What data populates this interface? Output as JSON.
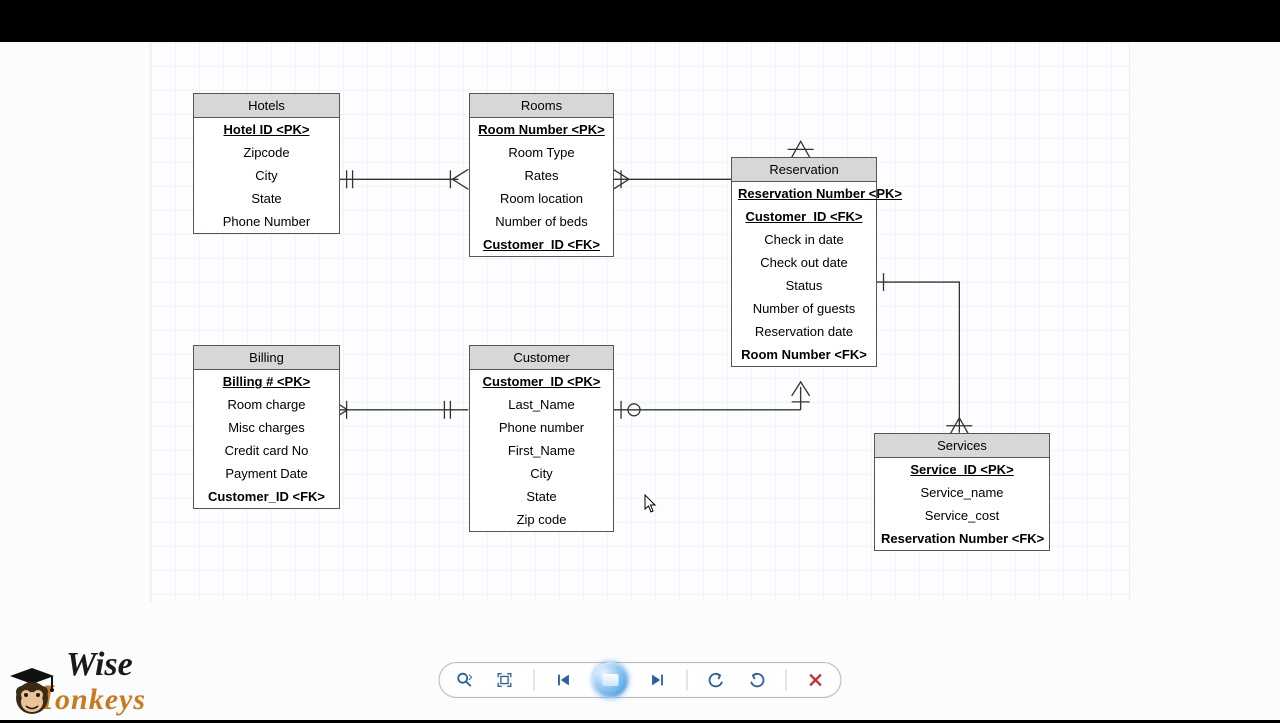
{
  "entities": {
    "hotels": {
      "title": "Hotels",
      "rows": [
        {
          "text": "Hotel ID <PK>",
          "cls": "pk"
        },
        {
          "text": "Zipcode"
        },
        {
          "text": "City"
        },
        {
          "text": "State"
        },
        {
          "text": "Phone Number"
        }
      ]
    },
    "rooms": {
      "title": "Rooms",
      "rows": [
        {
          "text": "Room Number <PK>",
          "cls": "pk"
        },
        {
          "text": "Room Type"
        },
        {
          "text": "Rates"
        },
        {
          "text": "Room location"
        },
        {
          "text": "Number of beds"
        },
        {
          "text": "Customer_ID <FK>",
          "cls": "fku"
        }
      ]
    },
    "reservation": {
      "title": "Reservation",
      "rows": [
        {
          "text": "Reservation Number <PK>",
          "cls": "pk"
        },
        {
          "text": "Customer_ID <FK>",
          "cls": "fku"
        },
        {
          "text": "Check in date"
        },
        {
          "text": "Check out date"
        },
        {
          "text": "Status"
        },
        {
          "text": "Number of guests"
        },
        {
          "text": "Reservation date"
        },
        {
          "text": "Room Number <FK>",
          "cls": "fk"
        }
      ]
    },
    "billing": {
      "title": "Billing",
      "rows": [
        {
          "text": "Billing # <PK>",
          "cls": "pk"
        },
        {
          "text": "Room charge"
        },
        {
          "text": "Misc charges"
        },
        {
          "text": "Credit card No"
        },
        {
          "text": "Payment Date"
        },
        {
          "text": "Customer_ID <FK>",
          "cls": "fk"
        }
      ]
    },
    "customer": {
      "title": "Customer",
      "rows": [
        {
          "text": "Customer_ID <PK>",
          "cls": "pk"
        },
        {
          "text": "Last_Name"
        },
        {
          "text": "Phone number"
        },
        {
          "text": "First_Name"
        },
        {
          "text": "City"
        },
        {
          "text": "State"
        },
        {
          "text": "Zip code"
        }
      ]
    },
    "services": {
      "title": "Services",
      "rows": [
        {
          "text": "Service_ID <PK>",
          "cls": "pk"
        },
        {
          "text": "Service_name"
        },
        {
          "text": "Service_cost"
        },
        {
          "text": "Reservation Number <FK>",
          "cls": "fk"
        }
      ]
    }
  },
  "logo": {
    "line1": "Wise",
    "line2": "onkeys"
  },
  "toolbar": {
    "zoom": "zoom",
    "fit": "fit",
    "prev": "prev",
    "play": "play",
    "next": "next",
    "undo": "undo",
    "redo": "redo",
    "close": "close"
  }
}
